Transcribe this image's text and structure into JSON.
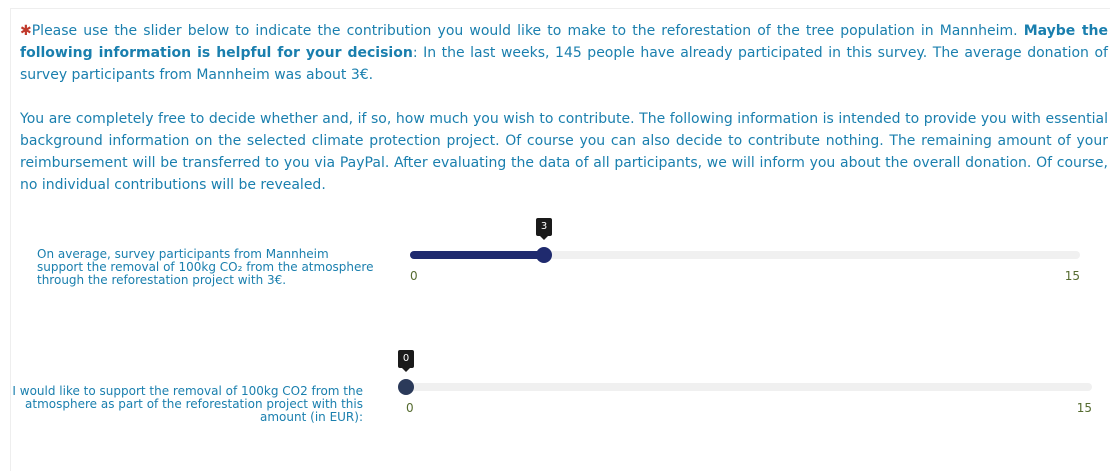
{
  "instructions": {
    "marker": "✱",
    "p1_intro": "Please use the slider below to indicate the contribution you would like to make to the reforestation of the tree population in Mannheim. ",
    "p1_bold": "Maybe the following information is helpful for your decision",
    "p1_rest": ": In the last weeks, 145 people have already participated in this survey. The average donation of survey participants from Mannheim was about 3€.",
    "p2": "You are completely free to decide whether and, if so, how much you wish to contribute. The following information is intended to provide you with essential background information on the selected climate protection project. Of course you can also decide to contribute nothing. The remaining amount of your reimbur­sement will be transferred to you via PayPal. After evaluating the data of all participants, we will inform you about the overall donation. Of course, no individual contributions will be revealed."
  },
  "sliders": [
    {
      "label": "On average, survey participants from Mannheim support the removal of 100kg CO₂ from the atmosphere through the reforestation project with 3€.",
      "min": 0,
      "max": 15,
      "value": 3,
      "min_label": "0",
      "max_label": "15",
      "tooltip": "3",
      "fill_color": "#1f2a6e"
    },
    {
      "label": "I would like to support the removal of 100kg CO2 from the atmosphere as part of the reforestation project with this amount (in EUR):",
      "min": 0,
      "max": 15,
      "value": 0,
      "min_label": "0",
      "max_label": "15",
      "tooltip": "0",
      "fill_color": "#2b3a5a"
    }
  ],
  "colors": {
    "text": "#1a7fae",
    "marker": "#c0392b",
    "tick": "#556b2f",
    "tooltip_bg": "#1a1a1a",
    "track": "#f0f0f0"
  }
}
